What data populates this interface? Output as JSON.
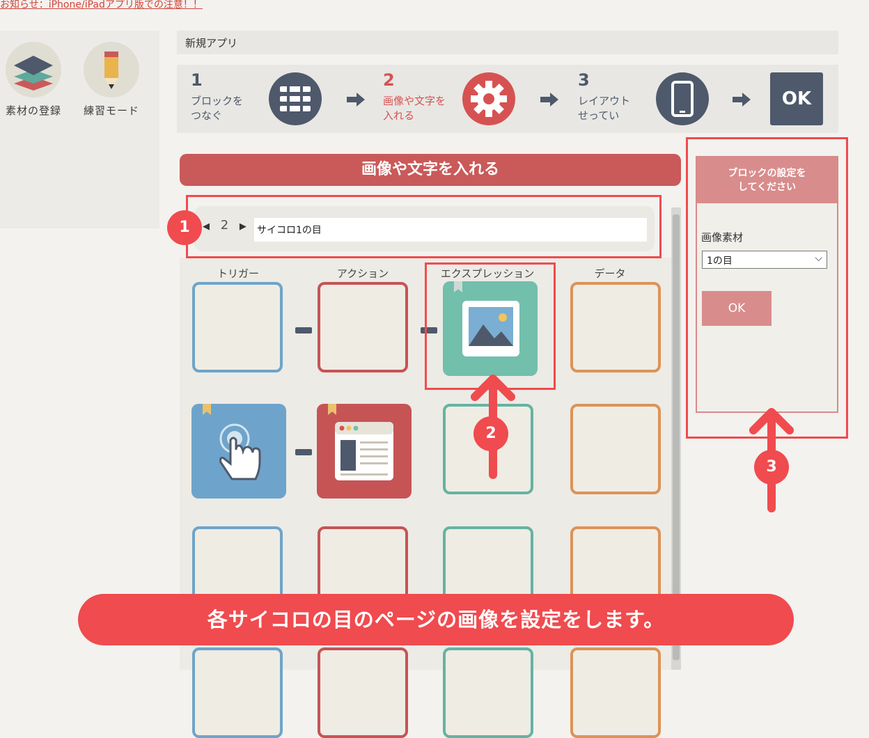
{
  "notice": {
    "link_text": "お知らせ：iPhone/iPadアプリ版での注意！！"
  },
  "tools": [
    {
      "label": "素材の登録",
      "icon": "layers-icon"
    },
    {
      "label": "練習モード",
      "icon": "pencil-icon"
    }
  ],
  "app": {
    "title": "新規アプリ"
  },
  "steps": [
    {
      "num": "1",
      "line1": "ブロックを",
      "line2": "つなぐ",
      "icon": "blocks-icon"
    },
    {
      "num": "2",
      "line1": "画像や文字を",
      "line2": "入れる",
      "icon": "gear-icon",
      "active": true
    },
    {
      "num": "3",
      "line1": "レイアウト",
      "line2": "せってい",
      "icon": "phone-icon"
    },
    {
      "ok_label": "OK"
    }
  ],
  "section": {
    "banner": "画像や文字を入れる"
  },
  "page_nav": {
    "prev": "◀",
    "page": "2",
    "next": "▶",
    "page_name": "サイコロ1の目"
  },
  "columns": [
    "トリガー",
    "アクション",
    "エクスプレッション",
    "データ"
  ],
  "settings": {
    "title_line1": "ブロックの設定を",
    "title_line2": "してください",
    "image_label": "画像素材",
    "image_value": "1の目",
    "ok_label": "OK"
  },
  "badges": [
    "1",
    "2",
    "3"
  ],
  "caption": "各サイコロの目のページの画像を設定をします。",
  "colors": {
    "accent": "#f04b4f",
    "banner": "#c95a59",
    "navy": "#4e596b",
    "panel_head": "#d98c8c"
  }
}
